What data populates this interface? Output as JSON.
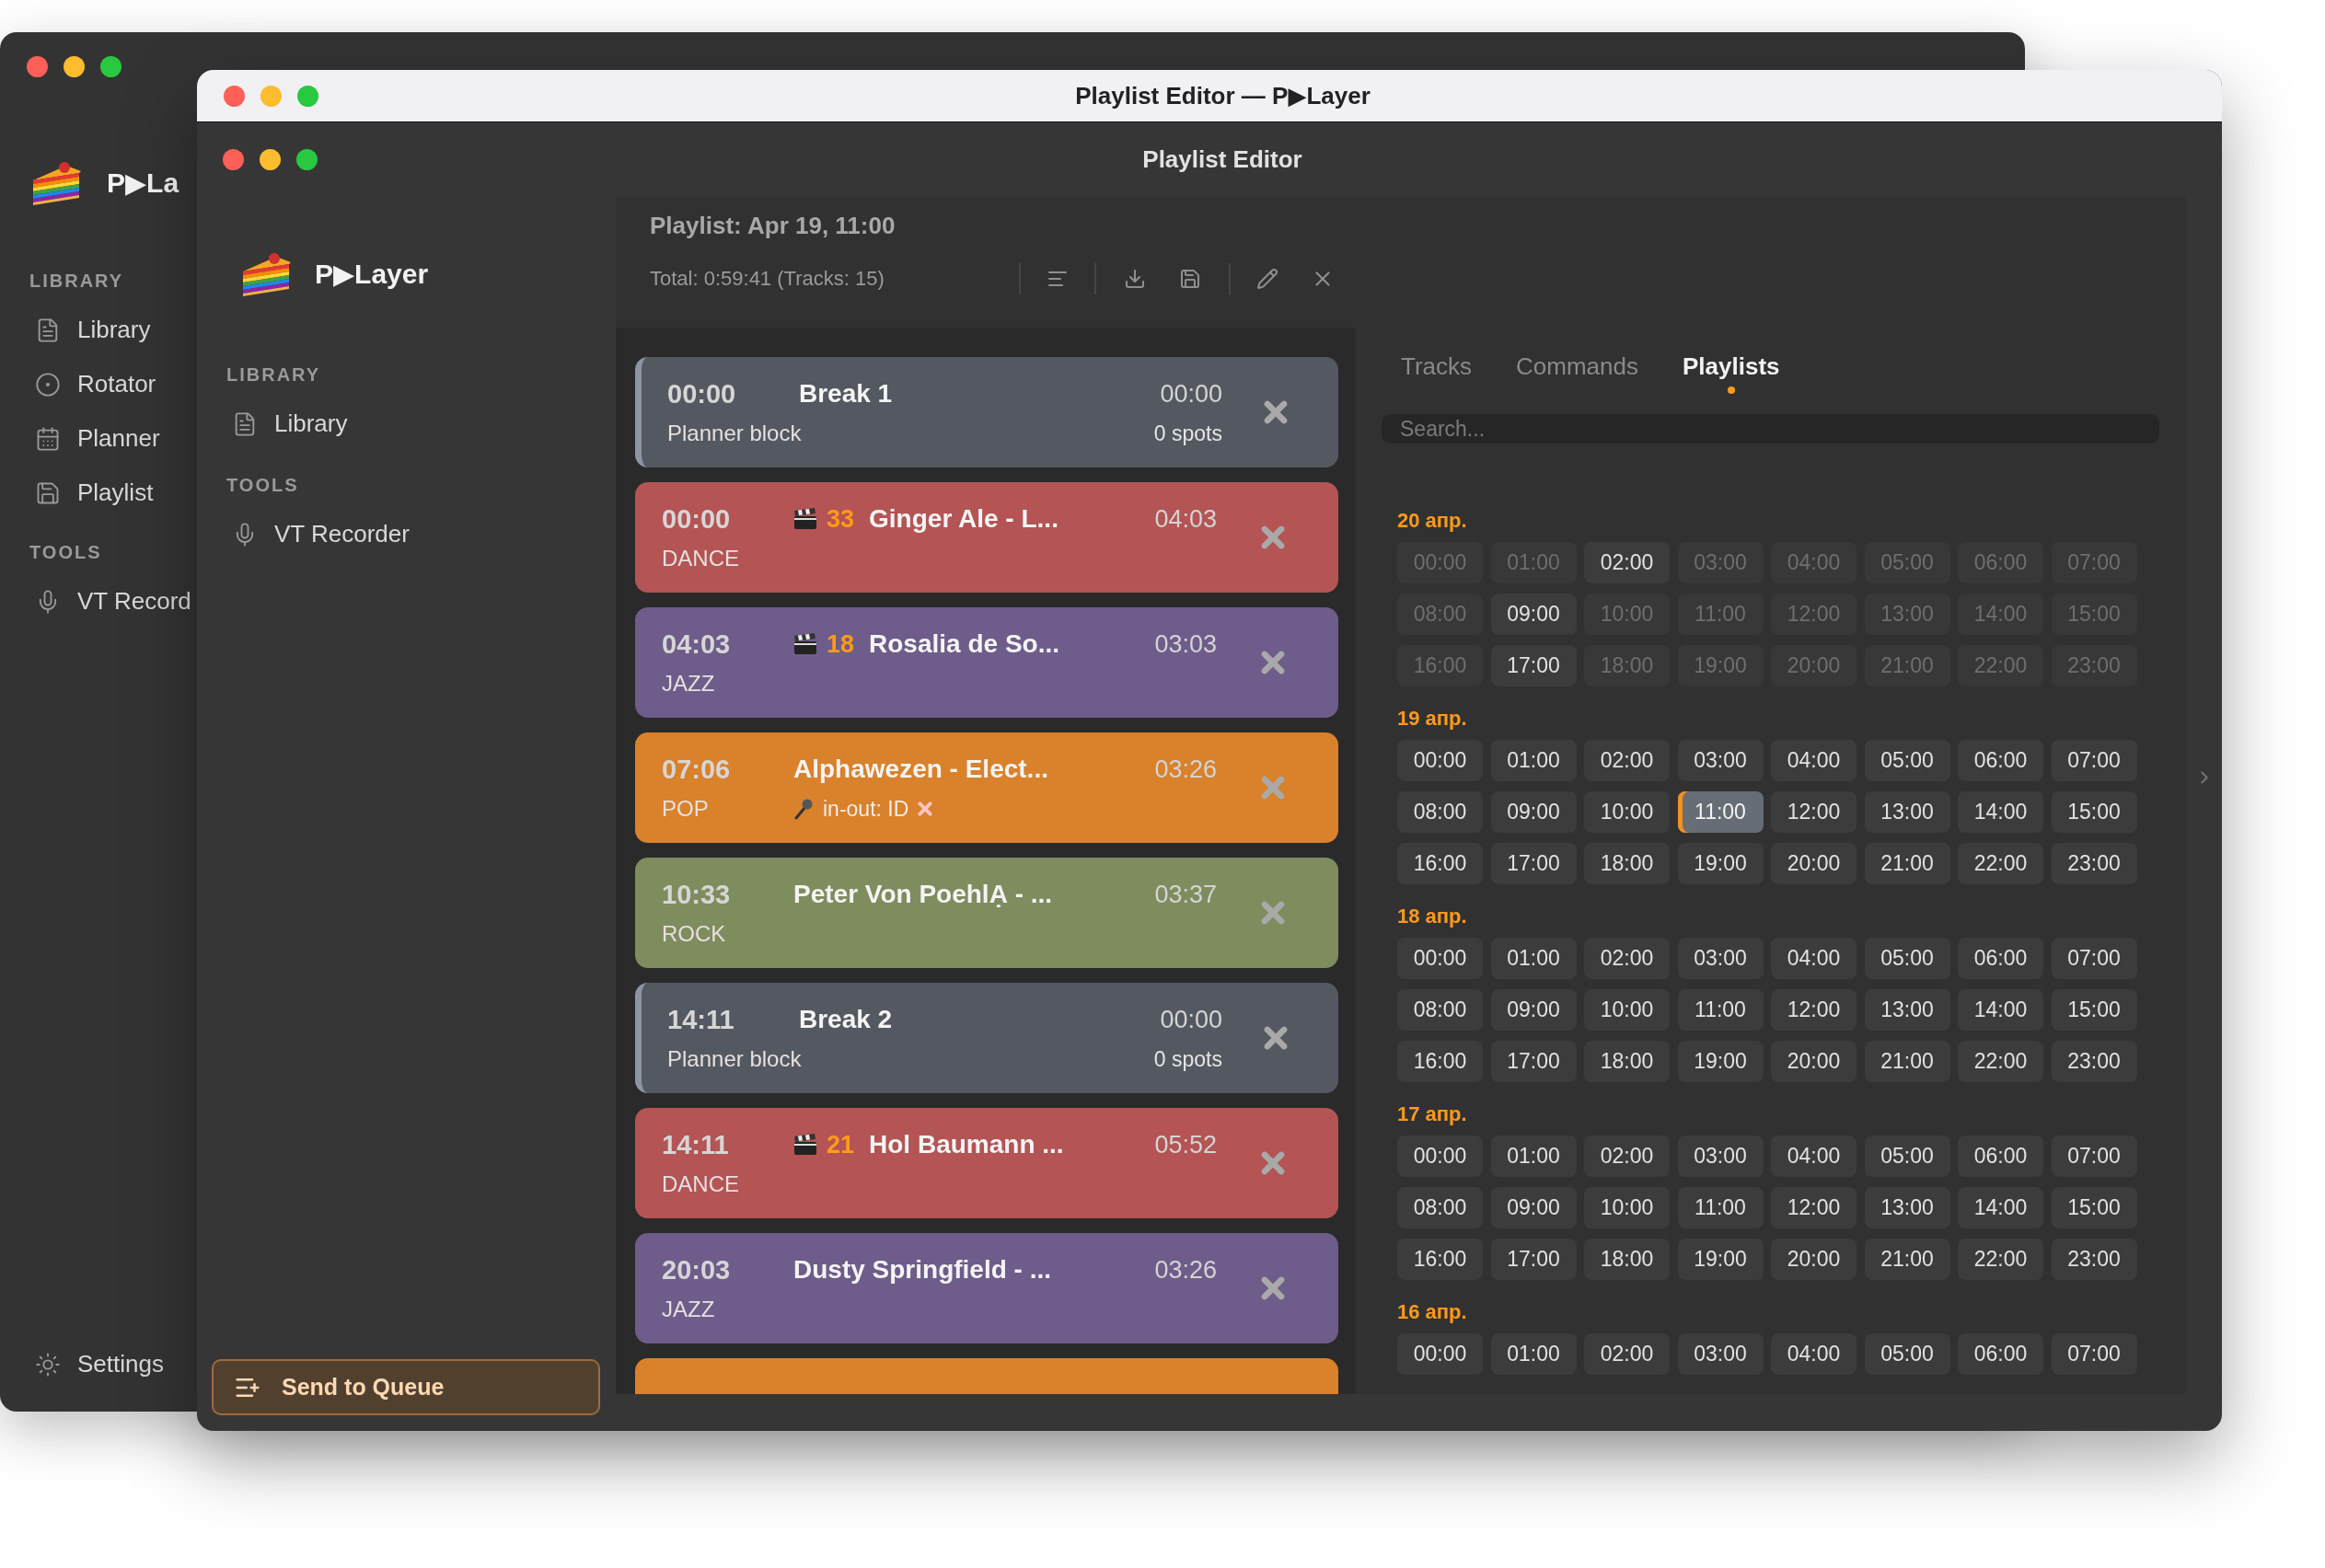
{
  "back_window": {
    "app_name": "P▶La",
    "sidebar": [
      {
        "heading": "LIBRARY",
        "items": [
          "Library",
          "Rotator",
          "Planner",
          "Playlist"
        ]
      },
      {
        "heading": "TOOLS",
        "items": [
          "VT Record"
        ]
      }
    ],
    "settings": "Settings"
  },
  "front_window": {
    "title": "Playlist Editor — P▶Layer",
    "header_title": "Playlist Editor",
    "app_name": "P▶Layer",
    "sidebar": [
      {
        "heading": "LIBRARY",
        "items": [
          "Library"
        ]
      },
      {
        "heading": "TOOLS",
        "items": [
          "VT Recorder"
        ]
      }
    ],
    "send_button": "Send to Queue",
    "playlist": {
      "title": "Playlist: Apr 19, 11:00",
      "summary": "Total: 0:59:41 (Tracks: 15)",
      "items": [
        {
          "kind": "break",
          "start": "00:00",
          "title": "Break 1",
          "duration": "00:00",
          "subtitle": "Planner block",
          "spots": "0 spots"
        },
        {
          "kind": "track",
          "start": "00:00",
          "genre": "DANCE",
          "color": "#b45454",
          "number": "33",
          "title": "Ginger Ale - L...",
          "duration": "04:03"
        },
        {
          "kind": "track",
          "start": "04:03",
          "genre": "JAZZ",
          "color": "#6e5c8a",
          "number": "18",
          "title": "Rosalia de So...",
          "duration": "03:03"
        },
        {
          "kind": "track",
          "start": "07:06",
          "genre": "POP",
          "color": "#d9812b",
          "title": "Alphawezen - Elect...",
          "duration": "03:26",
          "note": "in-out: ID"
        },
        {
          "kind": "track",
          "start": "10:33",
          "genre": "ROCK",
          "color": "#7f8c5e",
          "title": "Peter Von PoehlẠ - ...",
          "duration": "03:37"
        },
        {
          "kind": "break",
          "start": "14:11",
          "title": "Break 2",
          "duration": "00:00",
          "subtitle": "Planner block",
          "spots": "0 spots"
        },
        {
          "kind": "track",
          "start": "14:11",
          "genre": "DANCE",
          "color": "#b45454",
          "number": "21",
          "title": "Hol Baumann ...",
          "duration": "05:52"
        },
        {
          "kind": "track",
          "start": "20:03",
          "genre": "JAZZ",
          "color": "#6e5c8a",
          "title": "Dusty Springfield - ...",
          "duration": "03:26"
        },
        {
          "kind": "track",
          "color": "#d9812b"
        }
      ]
    },
    "tabs": [
      {
        "label": "Tracks",
        "selected": false
      },
      {
        "label": "Commands",
        "selected": false
      },
      {
        "label": "Playlists",
        "selected": true
      }
    ],
    "search": {
      "placeholder": "Search..."
    },
    "days": [
      {
        "label": "20 апр.",
        "slots": [
          {
            "time": "00:00",
            "available": false,
            "selected": false
          },
          {
            "time": "01:00",
            "available": false,
            "selected": false
          },
          {
            "time": "02:00",
            "available": true,
            "selected": false
          },
          {
            "time": "03:00",
            "available": false,
            "selected": false
          },
          {
            "time": "04:00",
            "available": false,
            "selected": false
          },
          {
            "time": "05:00",
            "available": false,
            "selected": false
          },
          {
            "time": "06:00",
            "available": false,
            "selected": false
          },
          {
            "time": "07:00",
            "available": false,
            "selected": false
          },
          {
            "time": "08:00",
            "available": false,
            "selected": false
          },
          {
            "time": "09:00",
            "available": true,
            "selected": false
          },
          {
            "time": "10:00",
            "available": false,
            "selected": false
          },
          {
            "time": "11:00",
            "available": false,
            "selected": false
          },
          {
            "time": "12:00",
            "available": false,
            "selected": false
          },
          {
            "time": "13:00",
            "available": false,
            "selected": false
          },
          {
            "time": "14:00",
            "available": false,
            "selected": false
          },
          {
            "time": "15:00",
            "available": false,
            "selected": false
          },
          {
            "time": "16:00",
            "available": false,
            "selected": false
          },
          {
            "time": "17:00",
            "available": true,
            "selected": false
          },
          {
            "time": "18:00",
            "available": false,
            "selected": false
          },
          {
            "time": "19:00",
            "available": false,
            "selected": false
          },
          {
            "time": "20:00",
            "available": false,
            "selected": false
          },
          {
            "time": "21:00",
            "available": false,
            "selected": false
          },
          {
            "time": "22:00",
            "available": false,
            "selected": false
          },
          {
            "time": "23:00",
            "available": false,
            "selected": false
          }
        ]
      },
      {
        "label": "19 апр.",
        "slots": [
          {
            "time": "00:00",
            "available": true,
            "selected": false
          },
          {
            "time": "01:00",
            "available": true,
            "selected": false
          },
          {
            "time": "02:00",
            "available": true,
            "selected": false
          },
          {
            "time": "03:00",
            "available": true,
            "selected": false
          },
          {
            "time": "04:00",
            "available": true,
            "selected": false
          },
          {
            "time": "05:00",
            "available": true,
            "selected": false
          },
          {
            "time": "06:00",
            "available": true,
            "selected": false
          },
          {
            "time": "07:00",
            "available": true,
            "selected": false
          },
          {
            "time": "08:00",
            "available": true,
            "selected": false
          },
          {
            "time": "09:00",
            "available": true,
            "selected": false
          },
          {
            "time": "10:00",
            "available": true,
            "selected": false
          },
          {
            "time": "11:00",
            "available": true,
            "selected": true
          },
          {
            "time": "12:00",
            "available": true,
            "selected": false
          },
          {
            "time": "13:00",
            "available": true,
            "selected": false
          },
          {
            "time": "14:00",
            "available": true,
            "selected": false
          },
          {
            "time": "15:00",
            "available": true,
            "selected": false
          },
          {
            "time": "16:00",
            "available": true,
            "selected": false
          },
          {
            "time": "17:00",
            "available": true,
            "selected": false
          },
          {
            "time": "18:00",
            "available": true,
            "selected": false
          },
          {
            "time": "19:00",
            "available": true,
            "selected": false
          },
          {
            "time": "20:00",
            "available": true,
            "selected": false
          },
          {
            "time": "21:00",
            "available": true,
            "selected": false
          },
          {
            "time": "22:00",
            "available": true,
            "selected": false
          },
          {
            "time": "23:00",
            "available": true,
            "selected": false
          }
        ]
      },
      {
        "label": "18 апр.",
        "slots": [
          {
            "time": "00:00",
            "available": true,
            "selected": false
          },
          {
            "time": "01:00",
            "available": true,
            "selected": false
          },
          {
            "time": "02:00",
            "available": true,
            "selected": false
          },
          {
            "time": "03:00",
            "available": true,
            "selected": false
          },
          {
            "time": "04:00",
            "available": true,
            "selected": false
          },
          {
            "time": "05:00",
            "available": true,
            "selected": false
          },
          {
            "time": "06:00",
            "available": true,
            "selected": false
          },
          {
            "time": "07:00",
            "available": true,
            "selected": false
          },
          {
            "time": "08:00",
            "available": true,
            "selected": false
          },
          {
            "time": "09:00",
            "available": true,
            "selected": false
          },
          {
            "time": "10:00",
            "available": true,
            "selected": false
          },
          {
            "time": "11:00",
            "available": true,
            "selected": false
          },
          {
            "time": "12:00",
            "available": true,
            "selected": false
          },
          {
            "time": "13:00",
            "available": true,
            "selected": false
          },
          {
            "time": "14:00",
            "available": true,
            "selected": false
          },
          {
            "time": "15:00",
            "available": true,
            "selected": false
          },
          {
            "time": "16:00",
            "available": true,
            "selected": false
          },
          {
            "time": "17:00",
            "available": true,
            "selected": false
          },
          {
            "time": "18:00",
            "available": true,
            "selected": false
          },
          {
            "time": "19:00",
            "available": true,
            "selected": false
          },
          {
            "time": "20:00",
            "available": true,
            "selected": false
          },
          {
            "time": "21:00",
            "available": true,
            "selected": false
          },
          {
            "time": "22:00",
            "available": true,
            "selected": false
          },
          {
            "time": "23:00",
            "available": true,
            "selected": false
          }
        ]
      },
      {
        "label": "17 апр.",
        "slots": [
          {
            "time": "00:00",
            "available": true,
            "selected": false
          },
          {
            "time": "01:00",
            "available": true,
            "selected": false
          },
          {
            "time": "02:00",
            "available": true,
            "selected": false
          },
          {
            "time": "03:00",
            "available": true,
            "selected": false
          },
          {
            "time": "04:00",
            "available": true,
            "selected": false
          },
          {
            "time": "05:00",
            "available": true,
            "selected": false
          },
          {
            "time": "06:00",
            "available": true,
            "selected": false
          },
          {
            "time": "07:00",
            "available": true,
            "selected": false
          },
          {
            "time": "08:00",
            "available": true,
            "selected": false
          },
          {
            "time": "09:00",
            "available": true,
            "selected": false
          },
          {
            "time": "10:00",
            "available": true,
            "selected": false
          },
          {
            "time": "11:00",
            "available": true,
            "selected": false
          },
          {
            "time": "12:00",
            "available": true,
            "selected": false
          },
          {
            "time": "13:00",
            "available": true,
            "selected": false
          },
          {
            "time": "14:00",
            "available": true,
            "selected": false
          },
          {
            "time": "15:00",
            "available": true,
            "selected": false
          },
          {
            "time": "16:00",
            "available": true,
            "selected": false
          },
          {
            "time": "17:00",
            "available": true,
            "selected": false
          },
          {
            "time": "18:00",
            "available": true,
            "selected": false
          },
          {
            "time": "19:00",
            "available": true,
            "selected": false
          },
          {
            "time": "20:00",
            "available": true,
            "selected": false
          },
          {
            "time": "21:00",
            "available": true,
            "selected": false
          },
          {
            "time": "22:00",
            "available": true,
            "selected": false
          },
          {
            "time": "23:00",
            "available": true,
            "selected": false
          }
        ]
      },
      {
        "label": "16 апр.",
        "slots": [
          {
            "time": "00:00",
            "available": true,
            "selected": false
          },
          {
            "time": "01:00",
            "available": true,
            "selected": false
          },
          {
            "time": "02:00",
            "available": true,
            "selected": false
          },
          {
            "time": "03:00",
            "available": true,
            "selected": false
          },
          {
            "time": "04:00",
            "available": true,
            "selected": false
          },
          {
            "time": "05:00",
            "available": true,
            "selected": false
          },
          {
            "time": "06:00",
            "available": true,
            "selected": false
          },
          {
            "time": "07:00",
            "available": true,
            "selected": false
          }
        ]
      }
    ]
  }
}
